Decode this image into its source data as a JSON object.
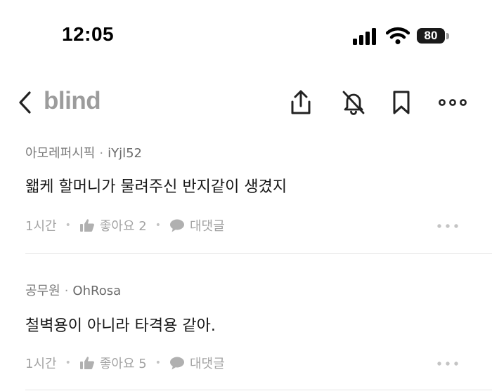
{
  "status_bar": {
    "time": "12:05",
    "battery": "80"
  },
  "nav": {
    "logo": "blind"
  },
  "comments": [
    {
      "company": "아모레퍼시픽",
      "separator": "·",
      "username": "iYjl52",
      "text": "왧케 할머니가 물려주신 반지같이 생겼지",
      "time": "1시간",
      "like_label": "좋아요 2",
      "reply_label": "대댓글"
    },
    {
      "company": "공무원",
      "separator": "·",
      "username": "OhRosa",
      "text": "철벽용이 아니라 타격용 같아.",
      "time": "1시간",
      "like_label": "좋아요 5",
      "reply_label": "대댓글"
    }
  ],
  "icons": {
    "back": "chevron-left-icon",
    "share": "share-icon",
    "notifications_off": "bell-off-icon",
    "bookmark": "bookmark-icon",
    "more": "more-horizontal-icon",
    "like": "thumbs-up-icon",
    "reply": "speech-bubble-icon"
  },
  "colors": {
    "logo": "#9c9c9c",
    "meta": "#7a7a7a",
    "action": "#a3a3a3",
    "text": "#161616"
  }
}
